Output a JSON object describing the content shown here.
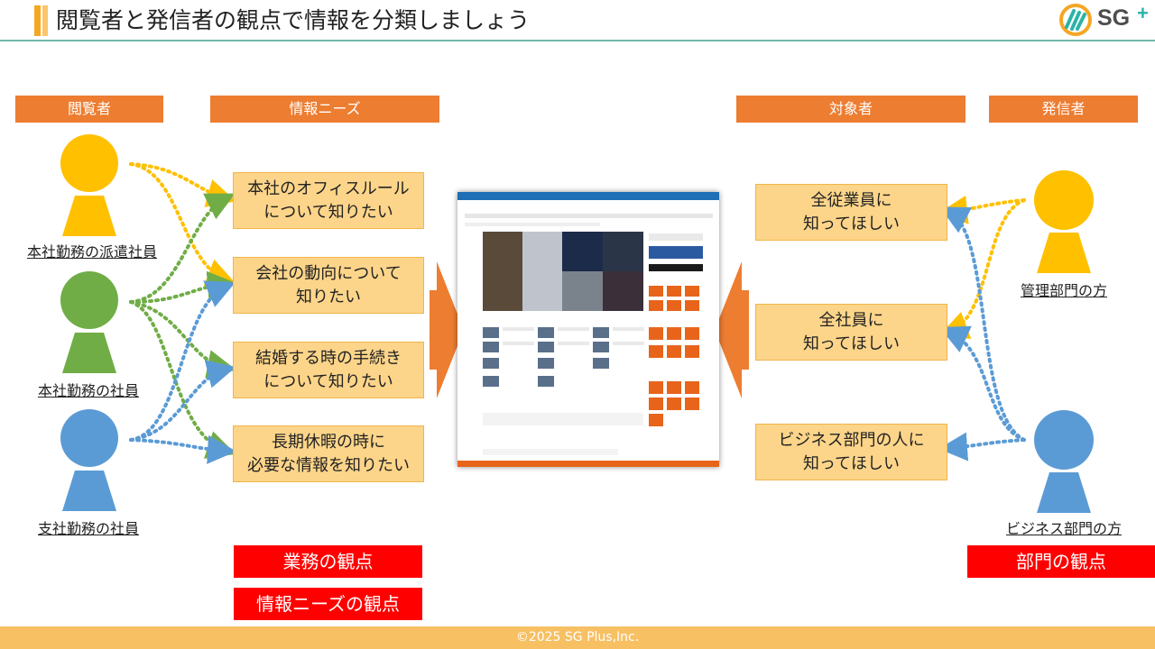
{
  "title": "閲覧者と発信者の観点で情報を分類しましょう",
  "logo": {
    "text": "SG",
    "plus": "+"
  },
  "headers": {
    "viewer": "閲覧者",
    "needs": "情報ニーズ",
    "audience": "対象者",
    "sender": "発信者"
  },
  "viewers": [
    {
      "label": "本社勤務の派遣社員",
      "color": "#ffc000"
    },
    {
      "label": "本社勤務の社員",
      "color": "#70ad47"
    },
    {
      "label": "支社勤務の社員",
      "color": "#5b9bd5"
    }
  ],
  "needs": [
    "本社のオフィスルール\nについて知りたい",
    "会社の動向について\n知りたい",
    "結婚する時の手続き\nについて知りたい",
    "長期休暇の時に\n必要な情報を知りたい"
  ],
  "audiences": [
    "全従業員に\n知ってほしい",
    "全社員に\n知ってほしい",
    "ビジネス部門の人に\n知ってほしい"
  ],
  "senders": [
    {
      "label": "管理部門の方",
      "color": "#ffc000"
    },
    {
      "label": "ビジネス部門の方",
      "color": "#5b9bd5"
    }
  ],
  "tags": {
    "business_view": "業務の観点",
    "needs_view": "情報ニーズの観点",
    "department_view": "部門の観点"
  },
  "footer": "©2025 SG Plus,Inc.",
  "colors": {
    "header_orange": "#ed7d31",
    "box_fill": "#fdd58a",
    "tag_red": "#ff0000",
    "footer": "#f7c063",
    "arrow": "#ed7d31"
  }
}
